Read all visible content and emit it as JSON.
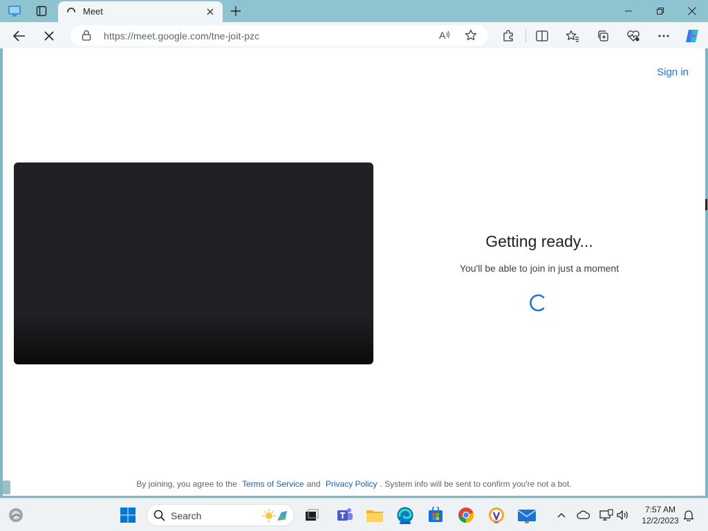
{
  "browser": {
    "tab": {
      "title": "Meet"
    },
    "address_bar": {
      "url": "https://meet.google.com/tne-joit-pzc"
    }
  },
  "page": {
    "sign_in_label": "Sign in",
    "status_title": "Getting ready...",
    "status_subtitle": "You'll be able to join in just a moment",
    "footer": {
      "prefix": "By joining, you agree to the",
      "terms_link": "Terms of Service",
      "conjunction": "and",
      "privacy_link": "Privacy Policy",
      "suffix": ". System info will be sent to confirm you're not a bot."
    }
  },
  "taskbar": {
    "search_label": "Search",
    "clock_time": "7:57 AM",
    "clock_date": "12/2/2023"
  },
  "colors": {
    "accent": "#1a73e8",
    "video_bg": "#202124",
    "titlebar": "#8ec3cf"
  }
}
